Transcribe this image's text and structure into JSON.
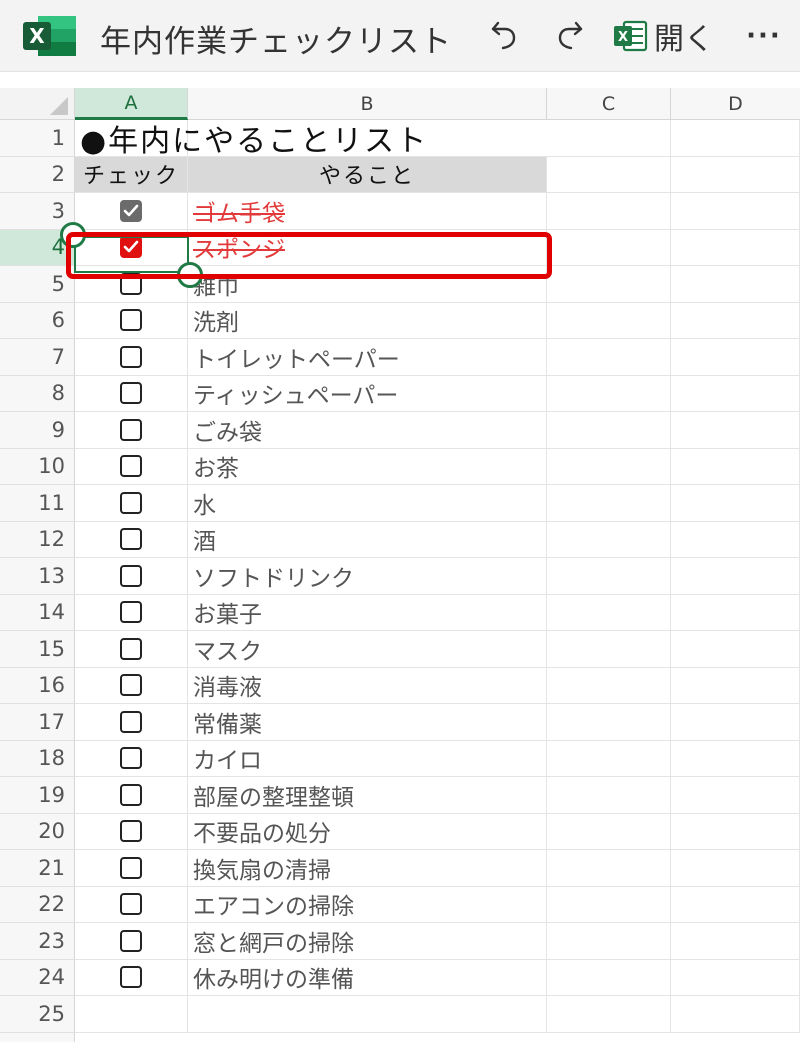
{
  "app": {
    "logo_letter": "X",
    "document_title": "年内作業チェックリスト",
    "toolbar": {
      "open_label": "開く",
      "more_label": "···"
    }
  },
  "columns": [
    "A",
    "B",
    "C",
    "D"
  ],
  "rows": [
    {
      "num": "1",
      "text": "●年内にやることリスト",
      "type": "title"
    },
    {
      "num": "2",
      "a": "チェック",
      "b": "やること",
      "type": "header"
    },
    {
      "num": "3",
      "b": "ゴム手袋",
      "check": "checked-gray"
    },
    {
      "num": "4",
      "b": "スポンジ",
      "check": "checked-red"
    },
    {
      "num": "5",
      "b": "雑巾",
      "check": "unchecked"
    },
    {
      "num": "6",
      "b": "洗剤",
      "check": "unchecked"
    },
    {
      "num": "7",
      "b": "トイレットペーパー",
      "check": "unchecked"
    },
    {
      "num": "8",
      "b": "ティッシュペーパー",
      "check": "unchecked"
    },
    {
      "num": "9",
      "b": "ごみ袋",
      "check": "unchecked"
    },
    {
      "num": "10",
      "b": "お茶",
      "check": "unchecked"
    },
    {
      "num": "11",
      "b": "水",
      "check": "unchecked"
    },
    {
      "num": "12",
      "b": "酒",
      "check": "unchecked"
    },
    {
      "num": "13",
      "b": "ソフトドリンク",
      "check": "unchecked"
    },
    {
      "num": "14",
      "b": "お菓子",
      "check": "unchecked"
    },
    {
      "num": "15",
      "b": "マスク",
      "check": "unchecked"
    },
    {
      "num": "16",
      "b": "消毒液",
      "check": "unchecked"
    },
    {
      "num": "17",
      "b": "常備薬",
      "check": "unchecked"
    },
    {
      "num": "18",
      "b": "カイロ",
      "check": "unchecked"
    },
    {
      "num": "19",
      "b": "部屋の整理整頓",
      "check": "unchecked"
    },
    {
      "num": "20",
      "b": "不要品の処分",
      "check": "unchecked"
    },
    {
      "num": "21",
      "b": "換気扇の清掃",
      "check": "unchecked"
    },
    {
      "num": "22",
      "b": "エアコンの掃除",
      "check": "unchecked"
    },
    {
      "num": "23",
      "b": "窓と網戸の掃除",
      "check": "unchecked"
    },
    {
      "num": "24",
      "b": "休み明けの準備",
      "check": "unchecked"
    },
    {
      "num": "25",
      "type": "empty"
    }
  ],
  "selection": {
    "active_column": "A",
    "active_row": "4"
  },
  "colors": {
    "excel_green": "#1f7a45",
    "strike_red": "#e23a3a",
    "annotation_red": "#e00000",
    "header_fill": "#d9d9d9"
  },
  "icons": [
    "excel-logo-icon",
    "undo-icon",
    "redo-icon",
    "excel-open-icon",
    "more-icon",
    "checkbox-icon",
    "checkmark-icon"
  ]
}
